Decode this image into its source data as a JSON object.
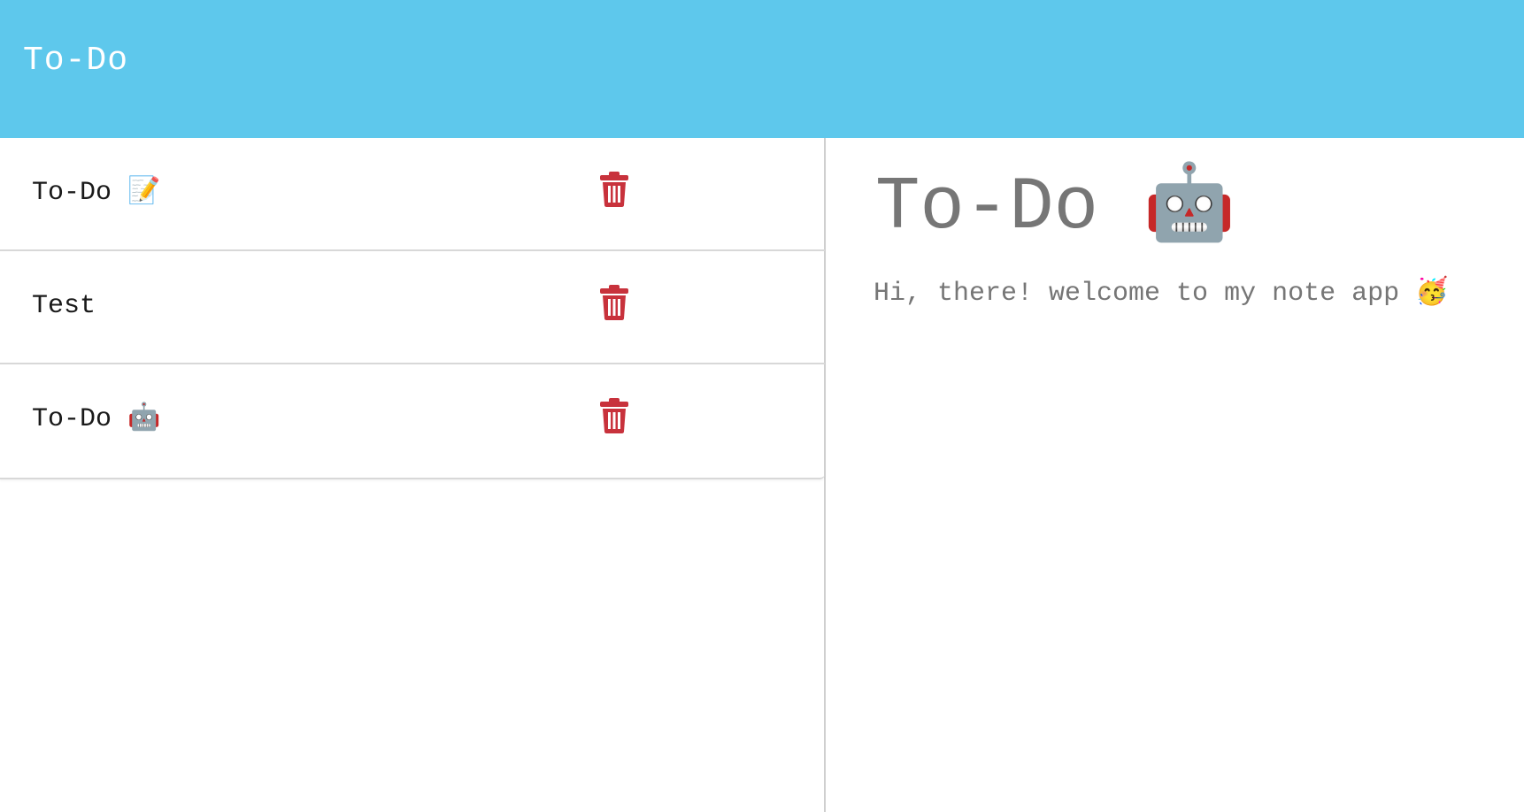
{
  "header": {
    "title": "To-Do",
    "background_color": "#5ec8ec"
  },
  "notes": [
    {
      "label": "To-Do 📝",
      "delete_icon": "trash-icon"
    },
    {
      "label": "Test",
      "delete_icon": "trash-icon"
    },
    {
      "label": "To-Do 🤖",
      "delete_icon": "trash-icon"
    }
  ],
  "detail": {
    "title": "To-Do 🤖",
    "body": "Hi, there! welcome to my note app 🥳"
  },
  "colors": {
    "delete": "#c8323c",
    "detail_text": "#767676"
  }
}
